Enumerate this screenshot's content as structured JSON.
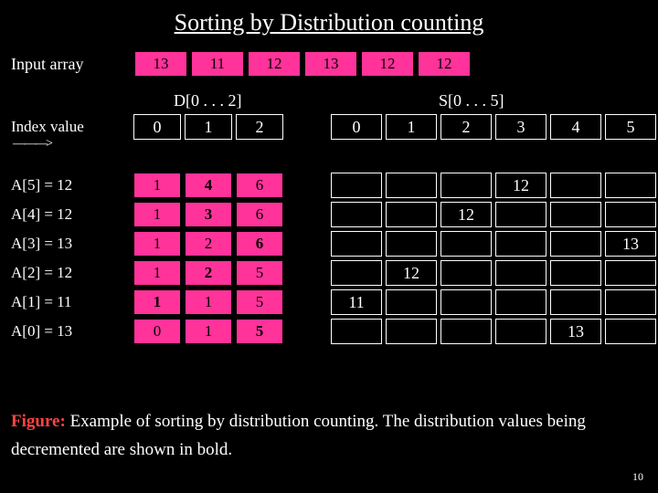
{
  "title": "Sorting by Distribution counting",
  "input_label": "Input array",
  "input_array": [
    "13",
    "11",
    "12",
    "13",
    "12",
    "12"
  ],
  "d_label": "D[0 . . . 2]",
  "s_label": "S[0 . . . 5]",
  "index_label": "Index value",
  "d_headers": [
    "0",
    "1",
    "2"
  ],
  "s_headers": [
    "0",
    "1",
    "2",
    "3",
    "4",
    "5"
  ],
  "steps": [
    {
      "label": "A[5] = 12",
      "d": [
        {
          "v": "1"
        },
        {
          "v": "4",
          "b": true
        },
        {
          "v": "6"
        }
      ],
      "s": {
        "3": "12"
      }
    },
    {
      "label": "A[4] = 12",
      "d": [
        {
          "v": "1"
        },
        {
          "v": "3",
          "b": true
        },
        {
          "v": "6"
        }
      ],
      "s": {
        "2": "12"
      }
    },
    {
      "label": "A[3] = 13",
      "d": [
        {
          "v": "1"
        },
        {
          "v": "2"
        },
        {
          "v": "6",
          "b": true
        }
      ],
      "s": {
        "5": "13"
      }
    },
    {
      "label": "A[2] = 12",
      "d": [
        {
          "v": "1"
        },
        {
          "v": "2",
          "b": true
        },
        {
          "v": "5"
        }
      ],
      "s": {
        "1": "12"
      }
    },
    {
      "label": "A[1] = 11",
      "d": [
        {
          "v": "1",
          "b": true
        },
        {
          "v": "1"
        },
        {
          "v": "5"
        }
      ],
      "s": {
        "0": "11"
      }
    },
    {
      "label": "A[0] = 13",
      "d": [
        {
          "v": "0"
        },
        {
          "v": "1"
        },
        {
          "v": "5",
          "b": true
        }
      ],
      "s": {
        "4": "13"
      }
    }
  ],
  "caption_prefix": "Figure:",
  "caption_rest": " Example of sorting by distribution counting. The distribution values being decremented are shown in bold.",
  "page_number": "10"
}
